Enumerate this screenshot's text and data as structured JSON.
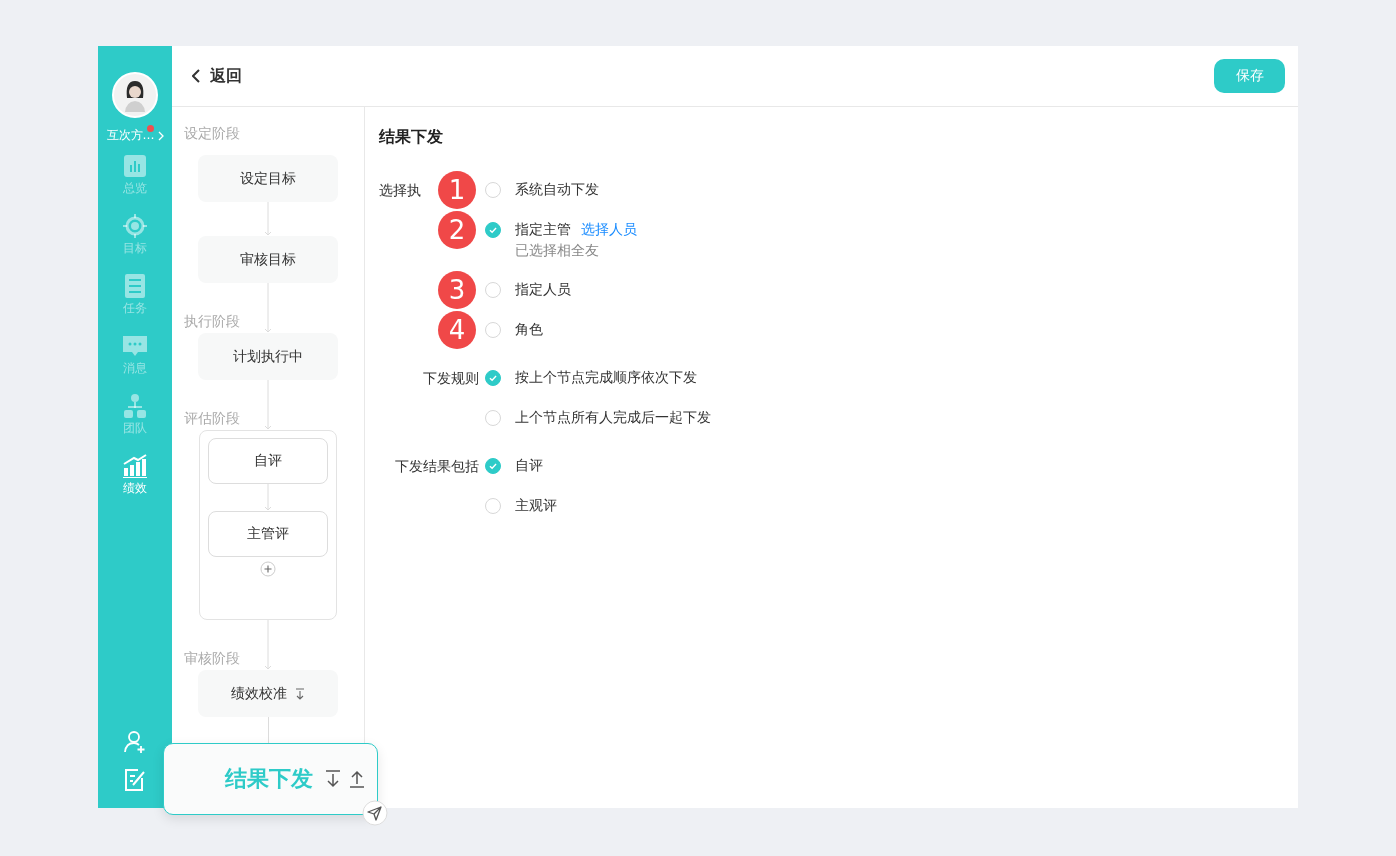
{
  "sidebar": {
    "user_name": "互次方…",
    "has_notice": true,
    "items": [
      {
        "label": "总览",
        "selected": false
      },
      {
        "label": "目标",
        "selected": false
      },
      {
        "label": "任务",
        "selected": false
      },
      {
        "label": "消息",
        "selected": false
      },
      {
        "label": "团队",
        "selected": false
      },
      {
        "label": "绩效",
        "selected": true
      }
    ]
  },
  "header": {
    "back": "返回",
    "save": "保存"
  },
  "stages": [
    {
      "label": "设定阶段",
      "kind": "plain",
      "nodes": [
        {
          "text": "设定目标",
          "kind": "plain"
        },
        {
          "text": "审核目标",
          "kind": "plain"
        }
      ]
    },
    {
      "label": "执行阶段",
      "kind": "plain",
      "nodes": [
        {
          "text": "计划执行中",
          "kind": "plain"
        }
      ]
    },
    {
      "label": "评估阶段",
      "kind": "group",
      "nodes": [
        {
          "text": "自评",
          "kind": "plain"
        },
        {
          "text": "主管评",
          "kind": "plain"
        }
      ]
    },
    {
      "label": "审核阶段",
      "kind": "plain",
      "nodes": [
        {
          "text": "绩效校准",
          "kind": "sortable"
        }
      ]
    }
  ],
  "drag_card": {
    "text": "结果下发"
  },
  "form": {
    "title": "结果下发",
    "sections": [
      {
        "label": "选择执",
        "options": [
          {
            "text": "系统自动下发",
            "checked": false,
            "badge": "1"
          },
          {
            "text": "指定主管",
            "checked": true,
            "badge": "2",
            "link": "选择人员",
            "note": "已选择相全友"
          },
          {
            "text": "指定人员",
            "checked": false,
            "badge": "3"
          },
          {
            "text": "角色",
            "checked": false,
            "badge": "4"
          }
        ]
      },
      {
        "label": "下发规则",
        "options": [
          {
            "text": "按上个节点完成顺序依次下发",
            "checked": true
          },
          {
            "text": "上个节点所有人完成后一起下发",
            "checked": false
          }
        ]
      },
      {
        "label": "下发结果包括",
        "options": [
          {
            "text": "自评",
            "checked": true
          },
          {
            "text": "主观评",
            "checked": false
          }
        ]
      }
    ]
  }
}
